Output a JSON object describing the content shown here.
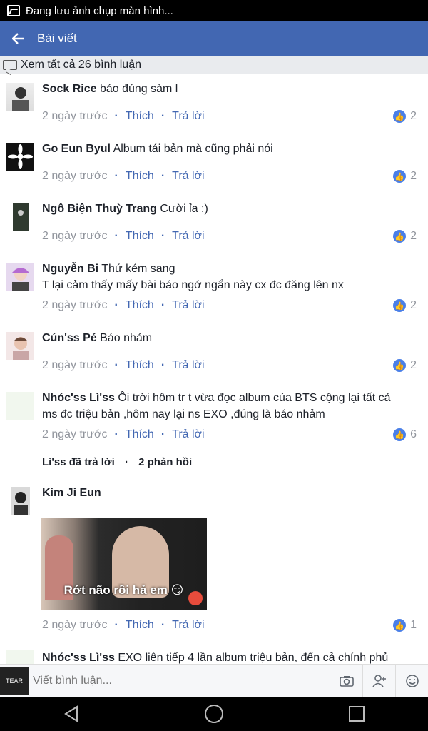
{
  "status_bar": {
    "text": "Đang lưu ảnh chụp màn hình..."
  },
  "app_bar": {
    "title": "Bài viết"
  },
  "view_all": {
    "label": "Xem tất cả 26 bình luận"
  },
  "comments": [
    {
      "author": "Sock Rice",
      "text": "báo đúng sàm l",
      "time": "2 ngày trước",
      "like": "Thích",
      "reply": "Trả lời",
      "likes": "2"
    },
    {
      "author": "Go Eun Byul",
      "text": "Album tái bản mà cũng phải nói",
      "time": "2 ngày trước",
      "like": "Thích",
      "reply": "Trả lời",
      "likes": "2"
    },
    {
      "author": "Ngô Biện Thuỳ Trang",
      "text": "Cười ỉa :)",
      "time": "2 ngày trước",
      "like": "Thích",
      "reply": "Trả lời",
      "likes": "2"
    },
    {
      "author": "Nguyễn Bi",
      "text": "Thứ kém sang",
      "text2": "T lại cảm thấy mấy bài báo ngớ ngẩn này cx đc đăng lên nx",
      "time": "2 ngày trước",
      "like": "Thích",
      "reply": "Trả lời",
      "likes": "2"
    },
    {
      "author": "Cún'ss Pé",
      "text": "Báo nhảm",
      "time": "2 ngày trước",
      "like": "Thích",
      "reply": "Trả lời",
      "likes": "2"
    },
    {
      "author": "Nhóc'ss Lì'ss",
      "text": "Ôi trời hôm tr t vừa đọc album của BTS cộng lại tất cả",
      "text2": "ms đc triệu bản ,hôm nay lại ns EXO ,đúng là báo nhảm",
      "time": "2 ngày trước",
      "like": "Thích",
      "reply": "Trả lời",
      "likes": "6"
    }
  ],
  "replies": {
    "who": "Lì'ss đã trả lời",
    "count": "2 phản hồi"
  },
  "reply_comment": {
    "author": "Kim Ji Eun",
    "image_caption": "Rớt não rồi hả em 😏",
    "time": "2 ngày trước",
    "like": "Thích",
    "reply": "Trả lời",
    "likes": "1"
  },
  "last_comment": {
    "author": "Nhóc'ss Lì'ss",
    "text": "EXO liên tiếp 4 lần album triệu bản, đến cả chính phủ"
  },
  "composer": {
    "placeholder": "Viết bình luận...",
    "avatar_text": "TEAR"
  },
  "colors": {
    "brand": "#4267b2",
    "like_badge": "#4a7fe8",
    "muted": "#90949c"
  },
  "icons": [
    "screenshot-icon",
    "back-arrow-icon",
    "comment-bubble-icon",
    "thumbs-up-icon",
    "camera-icon",
    "add-friend-icon",
    "emoji-icon",
    "nav-back-icon",
    "nav-home-icon",
    "nav-recents-icon"
  ]
}
